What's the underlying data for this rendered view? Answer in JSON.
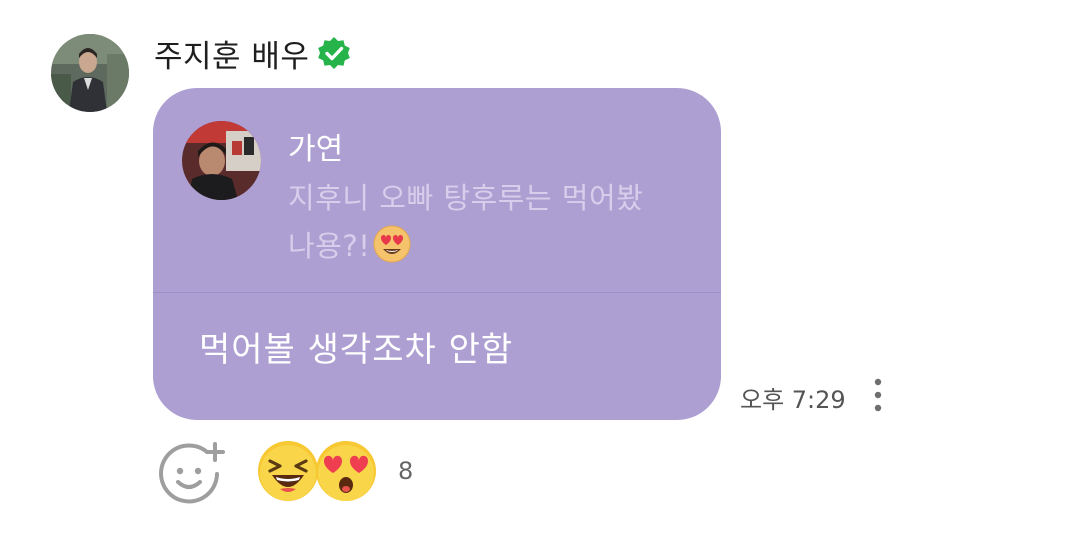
{
  "sender": {
    "name": "주지훈 배우",
    "verified": true,
    "avatar": "avatar-photo"
  },
  "bubble": {
    "color": "#ae9fd3",
    "reply": {
      "author": "가연",
      "avatar": "avatar-photo",
      "text_line1": "지후니 오빠 탕후루는 먹어봤",
      "text_line2": "나용?!",
      "emoji": "heart-eyes-emoji"
    },
    "message": "먹어볼 생각조차 안함"
  },
  "meta": {
    "timestamp": "오후 7:29",
    "more_icon": "more-vertical-icon"
  },
  "reactions": {
    "add_icon": "add-reaction-icon",
    "emojis": [
      "laughing-emoji",
      "heart-eyes-emoji"
    ],
    "count": "8"
  }
}
